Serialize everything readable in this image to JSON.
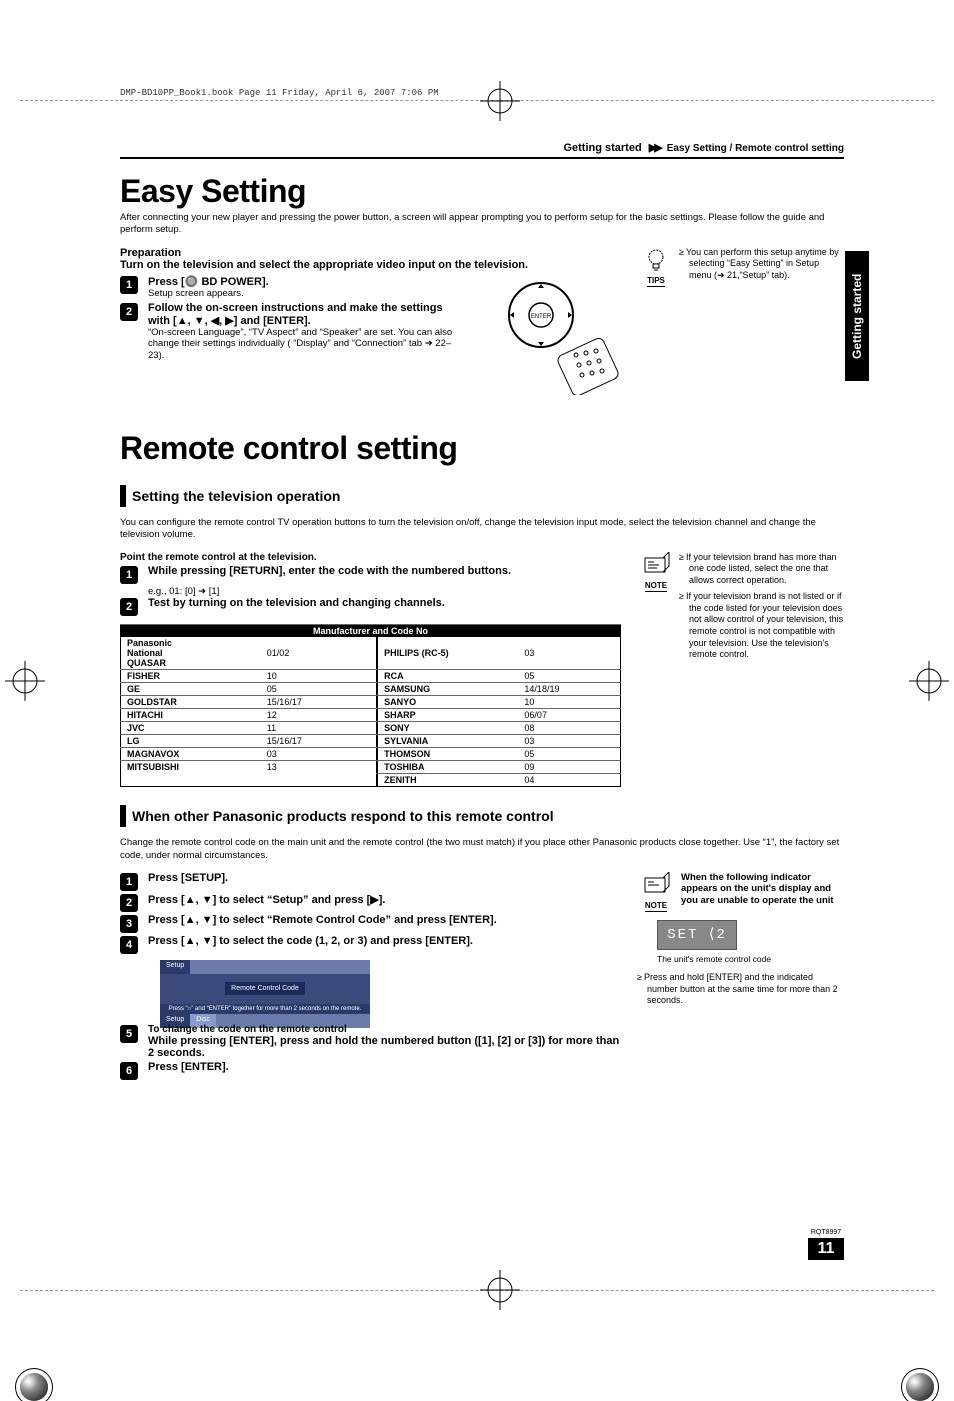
{
  "doc": {
    "bookmark_line": "DMP-BD10PP_Book1.book  Page 11  Friday, April 6, 2007  7:06 PM",
    "header_section": "Getting started",
    "header_chevron": "▶▶",
    "header_sub": "Easy Setting / Remote control setting",
    "side_tab": "Getting started",
    "rqt": "RQT8997",
    "page_number": "11"
  },
  "easy": {
    "title": "Easy Setting",
    "intro": "After connecting your new player and pressing the power button, a screen will appear prompting you to perform setup for the basic settings. Please follow the guide and perform setup.",
    "prep_heading": "Preparation",
    "prep_text": "Turn on the television and select the appropriate video input on the television.",
    "step1_bold": "Press [🔘 BD POWER].",
    "step1_plain": "Setup screen appears.",
    "step2_bold": "Follow the on-screen instructions and make the settings with [▲, ▼, ◀, ▶] and [ENTER].",
    "step2_plain": "“On-screen Language”, “TV Aspect” and “Speaker” are set. You can also change their settings individually ( “Display” and “Connection” tab ➜ 22–23).",
    "tips_label": "TIPS",
    "tips_bullet": "You can perform this setup anytime by selecting “Easy Setting” in Setup menu (➜ 21,“Setup” tab)."
  },
  "remote": {
    "title": "Remote control setting",
    "section1_title": "Setting the television operation",
    "section1_intro": "You can configure the remote control TV operation buttons to turn the television on/off, change the television input mode, select the television channel and change the television volume.",
    "point_text": "Point the remote control at the television.",
    "step1_bold": "While pressing [RETURN], enter the code with the numbered buttons.",
    "step1_eg": "e.g., 01: [0] ➜ [1]",
    "step2_bold": "Test by turning on the television and changing channels.",
    "note_label": "NOTE",
    "note_b1": "If your television brand has more than one code listed, select the one that allows correct operation.",
    "note_b2": "If your television brand is not listed or if the code listed for your television does not allow control of your television, this remote control is not compatible with your television. Use the television's remote control.",
    "table_caption": "Manufacturer and Code No",
    "codes_left": [
      {
        "brand": "Panasonic\nNational\nQUASAR",
        "code": "01/02",
        "group_first": true
      },
      {
        "brand": "FISHER",
        "code": "10"
      },
      {
        "brand": "GE",
        "code": "05"
      },
      {
        "brand": "GOLDSTAR",
        "code": "15/16/17"
      },
      {
        "brand": "HITACHI",
        "code": "12"
      },
      {
        "brand": "JVC",
        "code": "11"
      },
      {
        "brand": "LG",
        "code": "15/16/17"
      },
      {
        "brand": "MAGNAVOX",
        "code": "03"
      },
      {
        "brand": "MITSUBISHI",
        "code": "13"
      }
    ],
    "codes_right": [
      {
        "brand": "PHILIPS (RC-5)",
        "code": "03"
      },
      {
        "brand": "RCA",
        "code": "05"
      },
      {
        "brand": "SAMSUNG",
        "code": "14/18/19"
      },
      {
        "brand": "SANYO",
        "code": "10"
      },
      {
        "brand": "SHARP",
        "code": "06/07"
      },
      {
        "brand": "SONY",
        "code": "08"
      },
      {
        "brand": "SYLVANIA",
        "code": "03"
      },
      {
        "brand": "THOMSON",
        "code": "05"
      },
      {
        "brand": "TOSHIBA",
        "code": "09"
      },
      {
        "brand": "ZENITH",
        "code": "04"
      }
    ],
    "section2_title": "When other Panasonic products respond to this remote control",
    "section2_intro": "Change the remote control code on the main unit and the remote control (the two must match) if you place other Panasonic products close together. Use “1”, the factory set code, under normal circumstances.",
    "s2_step1": "Press [SETUP].",
    "s2_step2": "Press [▲, ▼] to select “Setup” and press [▶].",
    "s2_step3": "Press [▲, ▼] to select “Remote Control Code” and press [ENTER].",
    "s2_step4": "Press [▲, ▼] to select the code (1, 2, or 3) and press [ENTER].",
    "illus_tab_setup": "Setup",
    "illus_rcc": "Remote Control Code",
    "illus_hint": "Press “○” and “ENTER” together for more than 2 seconds on the remote.",
    "illus_tab_disc": "Disc",
    "s2_step5_a": "To change the code on the remote control",
    "s2_step5_b": "While pressing [ENTER], press and hold the numbered button ([1], [2] or [3]) for more than 2 seconds.",
    "s2_step6": "Press [ENTER].",
    "indicator_head": "When the following indicator appears on the unit's display and you are unable to operate the unit",
    "seg_text": "SET ⟨2",
    "seg_caption": "The unit's remote control code",
    "indicator_bullet": "Press and hold [ENTER] and the indicated number button at the same time for more than 2 seconds."
  }
}
